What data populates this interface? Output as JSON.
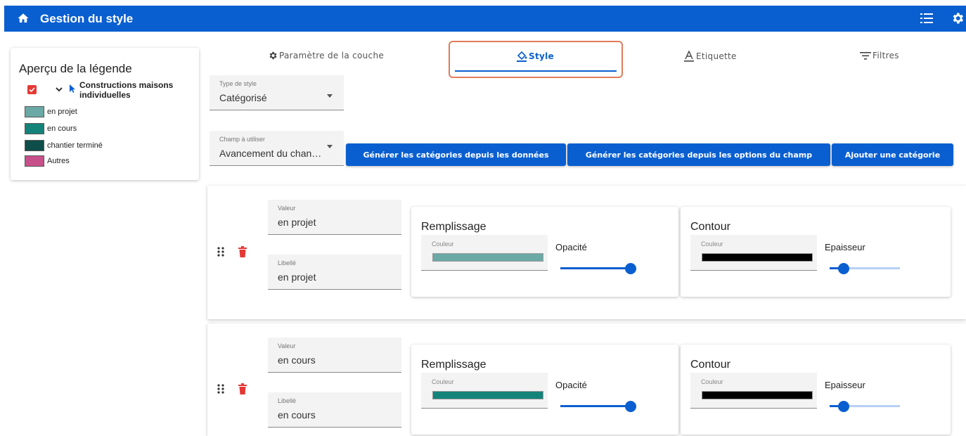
{
  "appbar": {
    "title": "Gestion du style"
  },
  "legend": {
    "title": "Aperçu de la légende",
    "layer_name": "Constructions maisons individuelles",
    "items": [
      {
        "label": "en projet",
        "color": "#6aa9a6"
      },
      {
        "label": "en cours",
        "color": "#14837a"
      },
      {
        "label": "chantier terminé",
        "color": "#0e4d49"
      },
      {
        "label": "Autres",
        "color": "#c8508a"
      }
    ]
  },
  "tabs": [
    {
      "label": "Paramètre de la couche",
      "icon": "gear-icon"
    },
    {
      "label": "Style",
      "icon": "paint-bucket-icon",
      "active": true
    },
    {
      "label": "Etiquette",
      "icon": "text-label-icon"
    },
    {
      "label": "Filtres",
      "icon": "filter-icon"
    }
  ],
  "style_type": {
    "label": "Type de style",
    "value": "Catégorisé"
  },
  "field_to_use": {
    "label": "Champ à utiliser",
    "value": "Avancement du chan…"
  },
  "buttons": {
    "generate_from_data": "Générer les catégories depuis les données",
    "generate_from_options": "Générer les catégories depuis les options du champ",
    "add_category": "Ajouter une catégorie"
  },
  "category_labels": {
    "value": "Valeur",
    "label": "Libellé",
    "fill": "Remplissage",
    "stroke": "Contour",
    "color": "Couleur",
    "opacity": "Opacité",
    "thickness": "Epaisseur"
  },
  "categories": [
    {
      "value": "en projet",
      "label": "en projet",
      "fill_color": "#6aa9a6",
      "stroke_color": "#000000",
      "opacity": 1.0,
      "thickness": 0.2
    },
    {
      "value": "en cours",
      "label": "en cours",
      "fill_color": "#14837a",
      "stroke_color": "#000000",
      "opacity": 1.0,
      "thickness": 0.2
    }
  ],
  "colors": {
    "primary": "#0a5fd0",
    "highlight": "#e07b5a",
    "delete": "#e53935"
  }
}
